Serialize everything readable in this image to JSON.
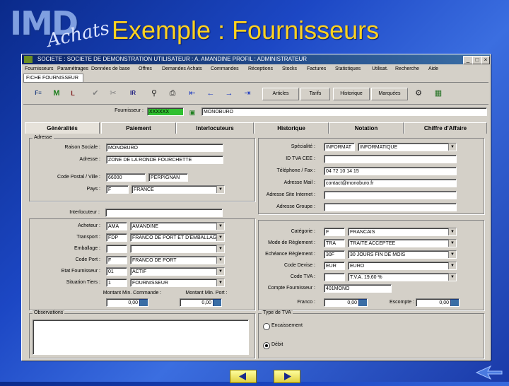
{
  "slide": {
    "logo_main": "IMD",
    "logo_sub": "Achats",
    "title": "Exemple : Fournisseurs"
  },
  "window": {
    "title": "SOCIETE : SOCIETE DE DEMONSTRATION   UTILISATEUR : A. AMANDINE   PROFIL : ADMINISTRATEUR"
  },
  "menu": [
    "Fournisseurs",
    "Paramétrages",
    "Données de base",
    "Offres",
    "Demandes Achats",
    "Commandes",
    "Réceptions",
    "Stocks",
    "Factures",
    "Statistiques",
    "Utilisat.",
    "Recherche",
    "Aide"
  ],
  "form_tab": "FICHE FOURNISSEUR",
  "toolbar": {
    "icons": [
      "FR",
      "M",
      "L",
      "check",
      "cancel",
      "IR",
      "binoculars",
      "print",
      "first",
      "prev",
      "next",
      "last",
      "settings",
      "export"
    ],
    "buttons": [
      "Articles",
      "Tarifs",
      "Historique",
      "Marquées"
    ]
  },
  "header": {
    "fournisseur_label": "Fournisseur :",
    "fournisseur_code": "XXXXXX",
    "fournisseur_name": "MONOBURO"
  },
  "tabs": [
    "Généralités",
    "Paiement",
    "Interlocuteurs",
    "Historique",
    "Notation",
    "Chiffre d'Affaire"
  ],
  "address": {
    "section": "Adresse",
    "rows": [
      {
        "label": "Raison Sociale :",
        "value": "MONOBURO"
      },
      {
        "label": "Adresse :",
        "value": "ZONE DE LA RONDE FOURCHETTE"
      },
      {
        "label": "Code Postal / Ville :",
        "value": "66000",
        "value2": "PERPIGNAN"
      },
      {
        "label": "Pays :",
        "value": "F",
        "value2": "FRANCE"
      }
    ]
  },
  "contact": {
    "rows": [
      {
        "label": "Spécialité :",
        "value": "INFORMATIQUE",
        "code": "INFORMAT"
      },
      {
        "label": "ID TVA CEE :",
        "value": ""
      },
      {
        "label": "Téléphone / Fax :",
        "value": "04 72 10 14 15"
      },
      {
        "label": "Adresse Mail :",
        "value": "contact@monoburo.fr"
      },
      {
        "label": "Adresse Site Internet :",
        "value": ""
      },
      {
        "label": "Adresse Groupe :",
        "value": ""
      }
    ]
  },
  "interlocuteur": {
    "label": "Interlocuteur :",
    "value": ""
  },
  "left_params": [
    {
      "label": "Acheteur :",
      "code": "AMA",
      "value": "AMANDINE"
    },
    {
      "label": "Transport :",
      "code": "FDP",
      "value": "FRANCO DE PORT ET D'EMBALLAGE"
    },
    {
      "label": "Emballage :",
      "code": "",
      "value": ""
    },
    {
      "label": "Code Port :",
      "code": "F",
      "value": "FRANCO DE PORT"
    },
    {
      "label": "Etat Fournisseur :",
      "code": "01",
      "value": "ACTIF"
    },
    {
      "label": "Situation Tiers :",
      "code": "1",
      "value": "FOURNISSEUR"
    }
  ],
  "mins": {
    "cmd_label": "Montant Min. Commande :",
    "cmd_value": "0,00",
    "port_label": "Montant Min. Port :",
    "port_value": "0,00"
  },
  "right_params": [
    {
      "label": "Catégorie :",
      "code": "F",
      "value": "FRANCAIS"
    },
    {
      "label": "Mode de Règlement :",
      "code": "TRA",
      "value": "TRAITE ACCEPTEE"
    },
    {
      "label": "Echéance Règlement :",
      "code": "30F",
      "value": "30 JOURS FIN DE MOIS"
    },
    {
      "label": "Code Devise :",
      "code": "EUR",
      "value": "EURO"
    },
    {
      "label": "Code TVA :",
      "code": "",
      "value": "T.V.A. 19,60 %"
    },
    {
      "label": "Compte Fournisseur :",
      "code": "401MONO",
      "value": ""
    }
  ],
  "remise": {
    "franco_label": "Franco :",
    "franco_value": "0,00",
    "escompte_label": "Escompte :",
    "escompte_value": "0,00"
  },
  "observations": {
    "label": "Observations",
    "value": ""
  },
  "tva": {
    "label": "Type de TVA",
    "opt1": "Encaissement",
    "opt2": "Débit"
  }
}
